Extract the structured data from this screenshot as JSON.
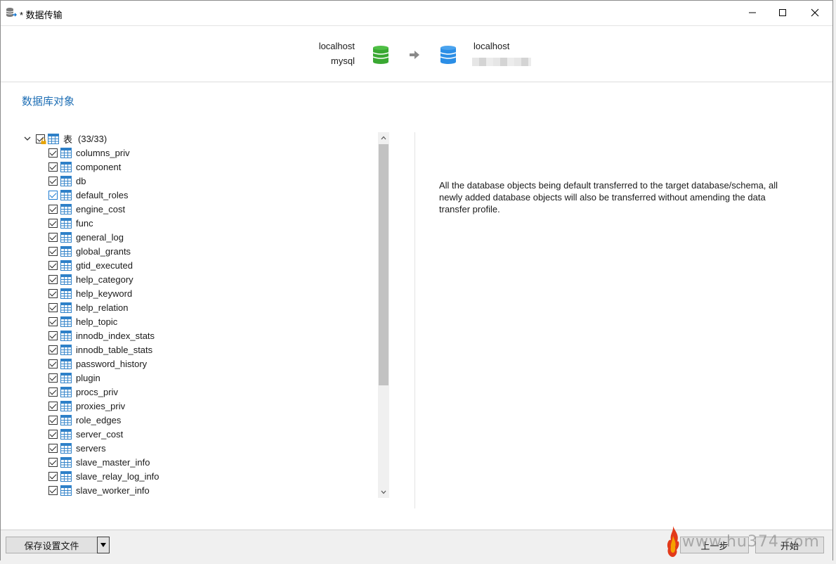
{
  "window": {
    "title": "* 数据传输",
    "icons": {
      "app": "database-stack-icon",
      "minimize": "minimize-icon",
      "maximize": "maximize-icon",
      "close": "close-icon"
    }
  },
  "header": {
    "source": {
      "host": "localhost",
      "database": "mysql",
      "icon": "database-green-icon",
      "color": "#3aa832"
    },
    "arrow_icon": "arrow-right-icon",
    "target": {
      "host": "localhost",
      "database_redacted": true,
      "icon": "database-blue-icon",
      "color": "#2b8ee6"
    }
  },
  "section_title": "数据库对象",
  "tree": {
    "root": {
      "label": "表",
      "count": "(33/33)",
      "checked": true,
      "expanded": true
    },
    "items": [
      {
        "label": "columns_priv",
        "checked": true
      },
      {
        "label": "component",
        "checked": true
      },
      {
        "label": "db",
        "checked": true
      },
      {
        "label": "default_roles",
        "checked": true,
        "hover": true
      },
      {
        "label": "engine_cost",
        "checked": true
      },
      {
        "label": "func",
        "checked": true
      },
      {
        "label": "general_log",
        "checked": true
      },
      {
        "label": "global_grants",
        "checked": true
      },
      {
        "label": "gtid_executed",
        "checked": true
      },
      {
        "label": "help_category",
        "checked": true
      },
      {
        "label": "help_keyword",
        "checked": true
      },
      {
        "label": "help_relation",
        "checked": true
      },
      {
        "label": "help_topic",
        "checked": true
      },
      {
        "label": "innodb_index_stats",
        "checked": true
      },
      {
        "label": "innodb_table_stats",
        "checked": true
      },
      {
        "label": "password_history",
        "checked": true
      },
      {
        "label": "plugin",
        "checked": true
      },
      {
        "label": "procs_priv",
        "checked": true
      },
      {
        "label": "proxies_priv",
        "checked": true
      },
      {
        "label": "role_edges",
        "checked": true
      },
      {
        "label": "server_cost",
        "checked": true
      },
      {
        "label": "servers",
        "checked": true
      },
      {
        "label": "slave_master_info",
        "checked": true
      },
      {
        "label": "slave_relay_log_info",
        "checked": true
      },
      {
        "label": "slave_worker_info",
        "checked": true
      }
    ]
  },
  "description": "All the database objects being default transferred to the target database/schema, all newly added database objects will also be transferred without amending the data transfer profile.",
  "footer": {
    "save_settings": "保存设置文件",
    "previous": "上一步",
    "start": "开始",
    "watermark": "www.hu374.com"
  }
}
